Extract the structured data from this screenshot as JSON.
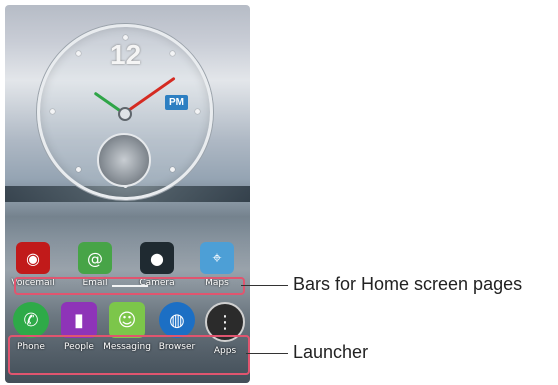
{
  "clock": {
    "number": "12",
    "period": "PM"
  },
  "apps": [
    {
      "label": "Voicemail",
      "icon": "voicemail-icon",
      "bg": "#c11a1a"
    },
    {
      "label": "Email",
      "icon": "email-icon",
      "bg": "#47a447"
    },
    {
      "label": "Camera",
      "icon": "camera-icon",
      "bg": "#1f2a31"
    },
    {
      "label": "Maps",
      "icon": "maps-icon",
      "bg": "#4d9fd6"
    }
  ],
  "dock": [
    {
      "label": "Phone",
      "icon": "phone-icon",
      "bg": "#2eaa48"
    },
    {
      "label": "People",
      "icon": "people-icon",
      "bg": "#8e34b8"
    },
    {
      "label": "Messaging",
      "icon": "messaging-icon",
      "bg": "#7cc64a"
    },
    {
      "label": "Browser",
      "icon": "browser-icon",
      "bg": "#1c6fc4"
    },
    {
      "label": "Apps",
      "icon": "apps-icon",
      "bg": "#2b2b2b"
    }
  ],
  "callouts": {
    "pages": "Bars for Home screen pages",
    "launcher": "Launcher"
  },
  "colors": {
    "callout_border": "#e0556f"
  }
}
